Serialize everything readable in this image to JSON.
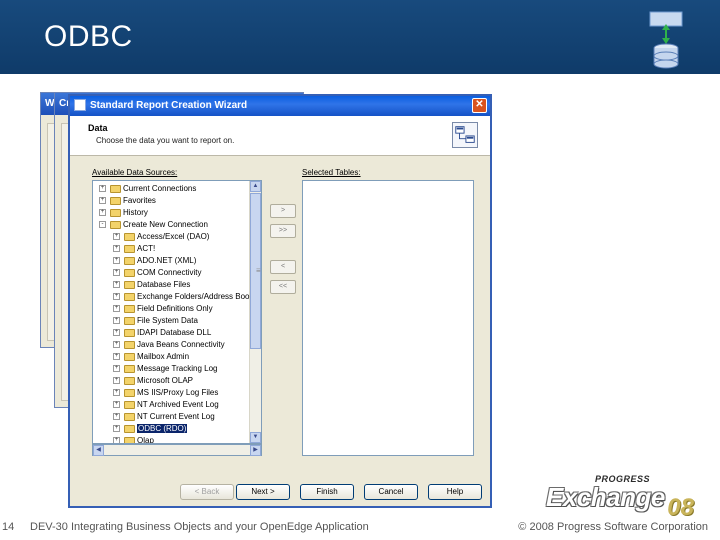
{
  "slide": {
    "title": "ODBC",
    "page_number": "14",
    "footer_text": "DEV-30 Integrating Business Objects and your OpenEdge Application",
    "copyright": "© 2008 Progress Software Corporation"
  },
  "logo": {
    "brand": "PROGRESS",
    "name": "Exchange",
    "year": "08"
  },
  "background_windows": [
    {
      "title": "W"
    },
    {
      "title": "Cr"
    }
  ],
  "dialog": {
    "title": "Standard Report Creation Wizard",
    "section_title": "Data",
    "section_subtitle": "Choose the data you want to report on.",
    "available_label": "Available Data Sources:",
    "selected_label": "Selected Tables:",
    "tree": [
      {
        "label": "Current Connections",
        "level": 0,
        "expander": "+"
      },
      {
        "label": "Favorites",
        "level": 0,
        "expander": "+"
      },
      {
        "label": "History",
        "level": 0,
        "expander": "+"
      },
      {
        "label": "Create New Connection",
        "level": 0,
        "expander": "-"
      },
      {
        "label": "Access/Excel (DAO)",
        "level": 1,
        "expander": "+"
      },
      {
        "label": "ACT!",
        "level": 1,
        "expander": "+"
      },
      {
        "label": "ADO.NET (XML)",
        "level": 1,
        "expander": "+"
      },
      {
        "label": "COM Connectivity",
        "level": 1,
        "expander": "+"
      },
      {
        "label": "Database Files",
        "level": 1,
        "expander": "+"
      },
      {
        "label": "Exchange Folders/Address Boo",
        "level": 1,
        "expander": "+"
      },
      {
        "label": "Field Definitions Only",
        "level": 1,
        "expander": "+"
      },
      {
        "label": "File System Data",
        "level": 1,
        "expander": "+"
      },
      {
        "label": "IDAPI Database DLL",
        "level": 1,
        "expander": "+"
      },
      {
        "label": "Java Beans Connectivity",
        "level": 1,
        "expander": "+"
      },
      {
        "label": "Mailbox Admin",
        "level": 1,
        "expander": "+"
      },
      {
        "label": "Message Tracking Log",
        "level": 1,
        "expander": "+"
      },
      {
        "label": "Microsoft OLAP",
        "level": 1,
        "expander": "+"
      },
      {
        "label": "MS IIS/Proxy Log Files",
        "level": 1,
        "expander": "+"
      },
      {
        "label": "NT Archived Event Log",
        "level": 1,
        "expander": "+"
      },
      {
        "label": "NT Current Event Log",
        "level": 1,
        "expander": "+"
      },
      {
        "label": "ODBC (RDO)",
        "level": 1,
        "expander": "+",
        "selected": true
      },
      {
        "label": "Olap",
        "level": 1,
        "expander": "+"
      }
    ],
    "move_buttons": [
      ">",
      ">>",
      "<",
      "<<"
    ],
    "buttons": {
      "back": "< Back",
      "next": "Next >",
      "finish": "Finish",
      "cancel": "Cancel",
      "help": "Help"
    }
  },
  "colors": {
    "header_bg": "#184a7d",
    "titlebar": "#1552c6",
    "selection": "#0a246a"
  }
}
